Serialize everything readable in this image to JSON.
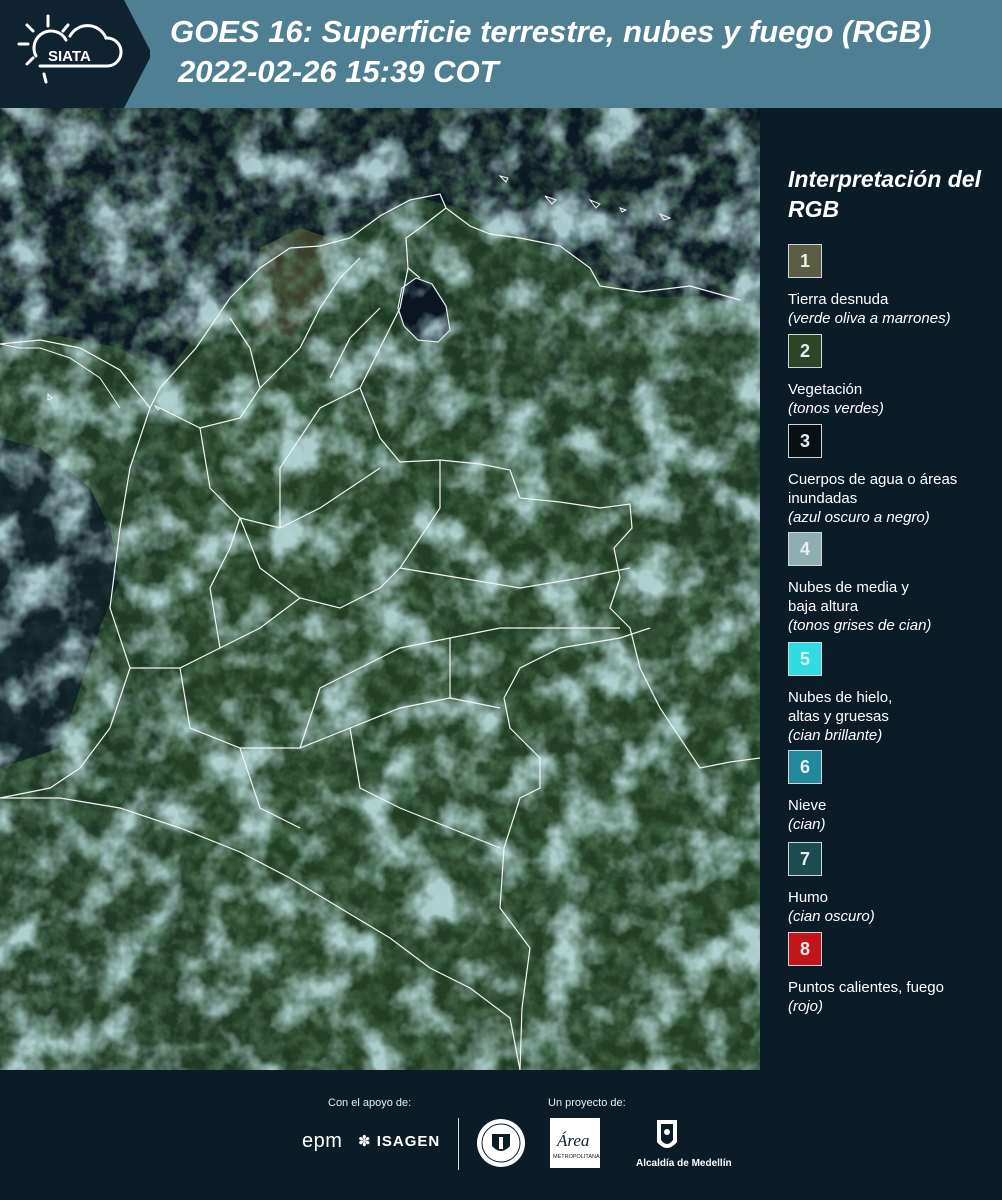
{
  "header": {
    "logo_text": "SIATA",
    "title": "GOES 16: Superficie terrestre, nubes y fuego (RGB)",
    "datetime": "2022-02-26 15:39 COT"
  },
  "legend": {
    "title": "Interpretación del RGB",
    "items": [
      {
        "num": "1",
        "label": "Tierra desnuda",
        "sub": "(verde oliva a marrones)",
        "color": "#5b5c44"
      },
      {
        "num": "2",
        "label": "Vegetación",
        "sub": "(tonos verdes)",
        "color": "#2d4425"
      },
      {
        "num": "3",
        "label": "Cuerpos de agua o áreas inundadas",
        "sub": "(azul oscuro a negro)",
        "color": "#0a0f14"
      },
      {
        "num": "4",
        "label": "Nubes de media y baja altura",
        "sub": "(tonos grises de cian)",
        "color": "#8eaeb0"
      },
      {
        "num": "5",
        "label": "Nubes de hielo, altas y gruesas",
        "sub": "(cian brillante)",
        "color": "#2fdce0"
      },
      {
        "num": "6",
        "label": "Nieve",
        "sub": "(cian)",
        "color": "#228a9c"
      },
      {
        "num": "7",
        "label": "Humo",
        "sub": "(cian oscuro)",
        "color": "#1c4c4f"
      },
      {
        "num": "8",
        "label": "Puntos calientes, fuego",
        "sub": "(rojo)",
        "color": "#c0161b"
      }
    ]
  },
  "footer": {
    "support_label": "Con el apoyo de:",
    "project_label": "Un proyecto de:",
    "sponsor_epm": "epm",
    "sponsor_isagen": "ISAGEN",
    "area_logo_text": "Área",
    "area_logo_subtext": "METROPOLITANA",
    "alcaldia": "Alcaldía de Medellín"
  }
}
